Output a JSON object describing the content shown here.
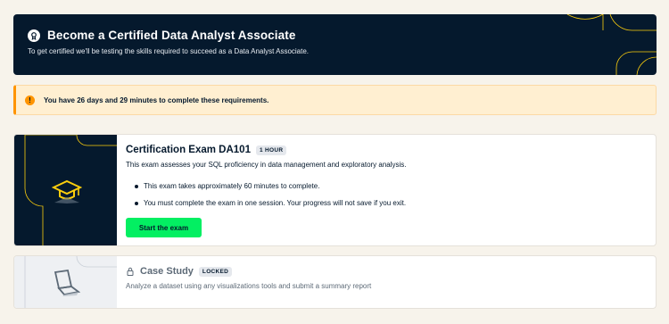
{
  "hero": {
    "title": "Become a Certified Data Analyst Associate",
    "subtitle": "To get certified we'll be testing the skills required to succeed as a Data Analyst Associate.",
    "icon": "ribbon-icon"
  },
  "warning": {
    "icon": "exclamation-icon",
    "text": "You have 26 days and 29 minutes to complete these requirements."
  },
  "exam": {
    "title": "Certification Exam DA101",
    "badge": "1 HOUR",
    "description": "This exam assesses your SQL proficiency in data management and exploratory analysis.",
    "bullets": [
      "This exam takes approximately 60 minutes to complete.",
      "You must complete the exam in one session. Your progress will not save if you exit."
    ],
    "button_label": "Start the exam",
    "thumb_icon": "graduation-cap-icon"
  },
  "case_study": {
    "title": "Case Study",
    "badge": "LOCKED",
    "description": "Analyze a dataset using any visualizations tools and submit a summary report",
    "thumb_icon": "laptop-icon",
    "lock_icon": "lock-icon"
  },
  "colors": {
    "navy": "#05192d",
    "accent_green": "#03ef62",
    "warning_orange": "#ff9400",
    "warning_bg": "#ffefd1",
    "gold": "#fcce0d",
    "page_bg": "#f7f3eb"
  }
}
